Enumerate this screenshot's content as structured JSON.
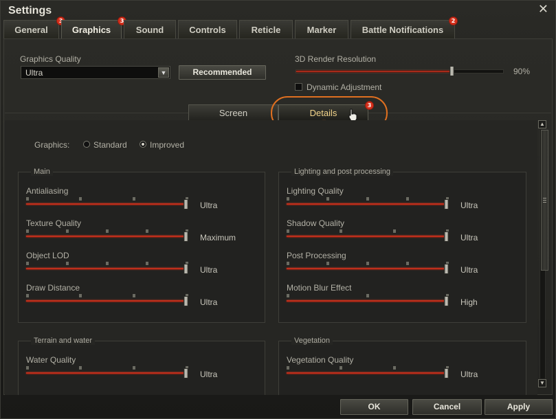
{
  "window": {
    "title": "Settings",
    "close_glyph": "✕"
  },
  "tabs": [
    {
      "label": "General",
      "badge": "3"
    },
    {
      "label": "Graphics",
      "badge": "3",
      "active": true
    },
    {
      "label": "Sound",
      "badge": ""
    },
    {
      "label": "Controls",
      "badge": ""
    },
    {
      "label": "Reticle",
      "badge": ""
    },
    {
      "label": "Marker",
      "badge": ""
    },
    {
      "label": "Battle Notifications",
      "badge": "2"
    }
  ],
  "graphics_quality": {
    "label": "Graphics Quality",
    "value": "Ultra",
    "recommended_label": "Recommended"
  },
  "render_resolution": {
    "label": "3D Render Resolution",
    "value_text": "90%",
    "level": 0.75
  },
  "dynamic_adjustment": {
    "label": "Dynamic Adjustment",
    "checked": false
  },
  "subtabs": {
    "screen": "Screen",
    "details": "Details",
    "details_badge": "3"
  },
  "graphics_mode": {
    "label": "Graphics:",
    "standard": "Standard",
    "improved": "Improved",
    "selected": "Improved"
  },
  "groups": {
    "main": {
      "title": "Main",
      "rows": [
        {
          "name": "Antialiasing",
          "value": "Ultra",
          "steps": 4,
          "level": 1.0
        },
        {
          "name": "Texture Quality",
          "value": "Maximum",
          "steps": 5,
          "level": 1.0
        },
        {
          "name": "Object LOD",
          "value": "Ultra",
          "steps": 5,
          "level": 1.0
        },
        {
          "name": "Draw Distance",
          "value": "Ultra",
          "steps": 4,
          "level": 1.0
        }
      ]
    },
    "lighting": {
      "title": "Lighting and post processing",
      "rows": [
        {
          "name": "Lighting Quality",
          "value": "Ultra",
          "steps": 5,
          "level": 1.0
        },
        {
          "name": "Shadow Quality",
          "value": "Ultra",
          "steps": 4,
          "level": 1.0
        },
        {
          "name": "Post Processing",
          "value": "Ultra",
          "steps": 5,
          "level": 1.0
        },
        {
          "name": "Motion Blur Effect",
          "value": "High",
          "steps": 3,
          "level": 1.0
        }
      ]
    },
    "terrain": {
      "title": "Terrain and water",
      "rows": [
        {
          "name": "Water Quality",
          "value": "Ultra",
          "steps": 4,
          "level": 1.0
        }
      ]
    },
    "vegetation": {
      "title": "Vegetation",
      "rows": [
        {
          "name": "Vegetation Quality",
          "value": "Ultra",
          "steps": 4,
          "level": 1.0
        }
      ]
    }
  },
  "footer": {
    "ok": "OK",
    "cancel": "Cancel",
    "apply": "Apply"
  },
  "colors": {
    "accent_orange": "#e07020",
    "slider_red": "#bf2f1c",
    "badge_red": "#d4301c",
    "active_tab_text": "#f3d48a"
  }
}
